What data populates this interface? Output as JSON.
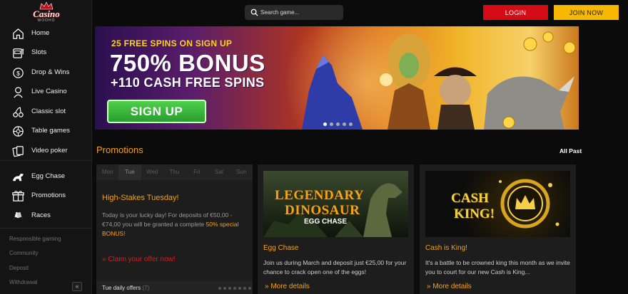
{
  "brand": {
    "name": "Casino",
    "tagline": "WOOHO"
  },
  "header": {
    "search_placeholder": "Search game...",
    "login_label": "LOGIN",
    "join_label": "JOIN NOW"
  },
  "sidebar": {
    "items": [
      {
        "label": "Home",
        "icon": "home-icon"
      },
      {
        "label": "Slots",
        "icon": "slot-machine-icon"
      },
      {
        "label": "Drop & Wins",
        "icon": "coin-drop-icon"
      },
      {
        "label": "Live Casino",
        "icon": "dealer-icon"
      },
      {
        "label": "Classic slot",
        "icon": "cherries-icon"
      },
      {
        "label": "Table games",
        "icon": "roulette-icon"
      },
      {
        "label": "Video poker",
        "icon": "cards-icon"
      },
      {
        "label": "Egg Chase",
        "icon": "dinosaur-icon"
      },
      {
        "label": "Promotions",
        "icon": "gift-icon"
      },
      {
        "label": "Races",
        "icon": "racing-flags-icon"
      }
    ],
    "links": [
      "Responsible gaming",
      "Community",
      "Deposit",
      "Withdrawal"
    ],
    "collapse_label": "«"
  },
  "banner": {
    "line1": "25 FREE SPINS ON SIGN UP",
    "line2": "750% BONUS",
    "line3": "+110 CASH FREE SPINS",
    "cta": "SIGN UP",
    "slides": 5,
    "active_slide": 1
  },
  "promotions": {
    "title": "Promotions",
    "all_past": "All Past",
    "daily": {
      "days": [
        "Mon",
        "Tue",
        "Wed",
        "Thu",
        "Fri",
        "Sat",
        "Sun"
      ],
      "active_day": "Tue",
      "heading": "High-Stakes Tuesday!",
      "body": "Today is your lucky day! For deposits of €50,00 - €74,00 you will be granted a complete",
      "highlight": "50% special BONUS",
      "body_end": "!",
      "claim": "» Claim your offer now!",
      "footer": "Tue daily offers",
      "footer_count": "(7)"
    },
    "cards": [
      {
        "image_title_1": "LEGENDARY",
        "image_title_2": "DINOSAUR",
        "image_title_3": "EGG CHASE",
        "title": "Egg Chase",
        "text": "Join us during March and deposit just €25,00 for your chance to crack open one of the eggs!",
        "more": "» More details"
      },
      {
        "image_title_1": "CASH",
        "image_title_2": "KING!",
        "title": "Cash is King!",
        "text": "It's a battle to be crowned king this month as we invite you to court for our new Cash is King...",
        "more": "» More details"
      }
    ]
  }
}
